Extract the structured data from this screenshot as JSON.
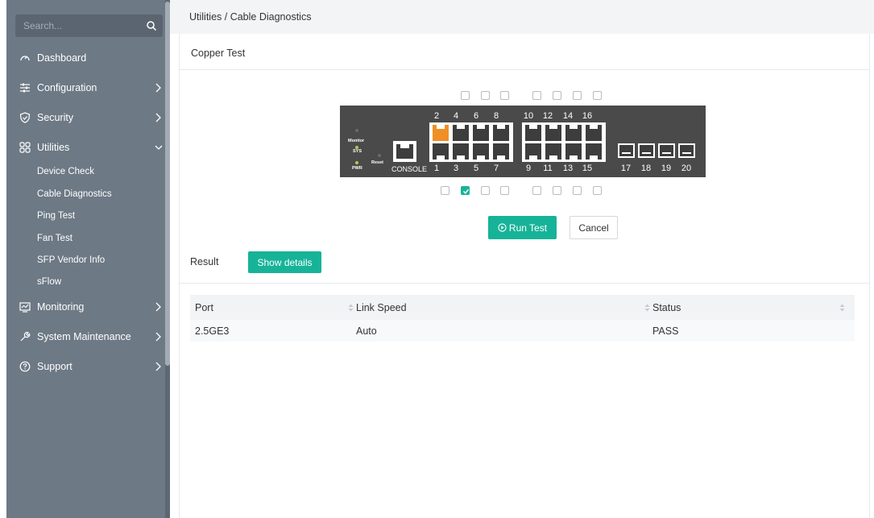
{
  "sidebar": {
    "search_placeholder": "Search...",
    "items": [
      {
        "label": "Dashboard",
        "icon": "dashboard-gauge-icon"
      },
      {
        "label": "Configuration",
        "icon": "sliders-icon"
      },
      {
        "label": "Security",
        "icon": "shield-icon"
      },
      {
        "label": "Utilities",
        "icon": "utilities-grid-icon",
        "expanded": true
      },
      {
        "label": "Monitoring",
        "icon": "monitor-chart-icon"
      },
      {
        "label": "System Maintenance",
        "icon": "wrench-icon"
      },
      {
        "label": "Support",
        "icon": "question-circle-icon"
      }
    ],
    "utilities_submenu": [
      "Device Check",
      "Cable Diagnostics",
      "Ping Test",
      "Fan Test",
      "SFP Vendor Info",
      "sFlow"
    ]
  },
  "breadcrumb": "Utilities /  Cable Diagnostics",
  "panel": {
    "title": "Copper Test"
  },
  "switch": {
    "top_ports": [
      "2",
      "4",
      "6",
      "8",
      "10",
      "12",
      "14",
      "16"
    ],
    "bottom_ports": [
      "1",
      "3",
      "5",
      "7",
      "9",
      "11",
      "13",
      "15"
    ],
    "sfp_ports": [
      "17",
      "18",
      "19",
      "20"
    ],
    "labels": {
      "monitor": "Monitor",
      "sys": "SYS",
      "pwr": "PWR",
      "reset": "Reset",
      "console": "CONSOLE"
    },
    "selected_port": "3",
    "active_port_color": "#ef8f24"
  },
  "actions": {
    "run_test": "Run Test",
    "cancel": "Cancel"
  },
  "result": {
    "label": "Result",
    "show_details": "Show details",
    "columns": [
      "Port",
      "Link Speed",
      "Status"
    ],
    "rows": [
      [
        "2.5GE3",
        "Auto",
        "PASS"
      ]
    ]
  },
  "colors": {
    "accent": "#17b398",
    "sidebar": "#6d7985"
  }
}
